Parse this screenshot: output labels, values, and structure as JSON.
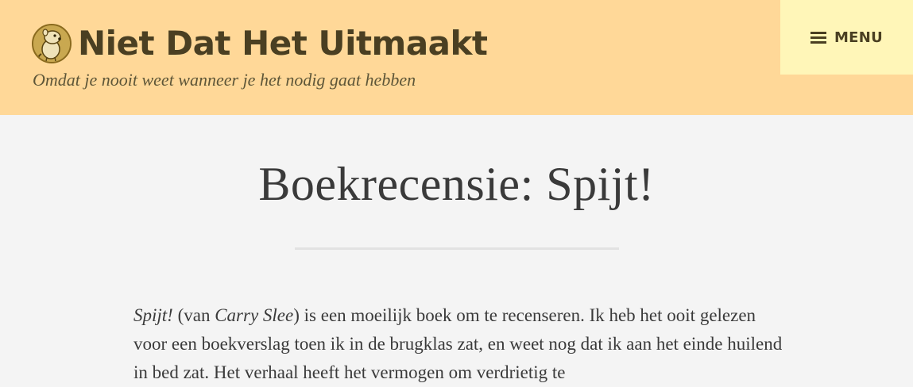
{
  "header": {
    "site_title": "Niet Dat Het Uitmaakt",
    "tagline": "Omdat je nooit weet wanneer je het nodig gaat hebben",
    "logo_icon": "beaver-mascot-icon",
    "menu_label": "MENU",
    "menu_icon": "hamburger-icon"
  },
  "post": {
    "title": "Boekrecensie: Spijt!",
    "intro": {
      "book_title": "Spijt!",
      "text_before_author": " (van ",
      "author": "Carry Slee",
      "text_after_author": ") is een moeilijk boek om te recenseren. Ik heb het ooit gelezen voor een boekverslag toen ik in de brugklas zat, en weet nog dat ik aan het einde huilend in bed zat. Het verhaal heeft het vermogen om verdrietig te"
    }
  },
  "colors": {
    "header_bg": "#ffd898",
    "menu_bg": "#fff6b8",
    "page_bg": "#f4f4f4",
    "title_text": "#4a3f22",
    "body_text": "#3a3a3a"
  }
}
